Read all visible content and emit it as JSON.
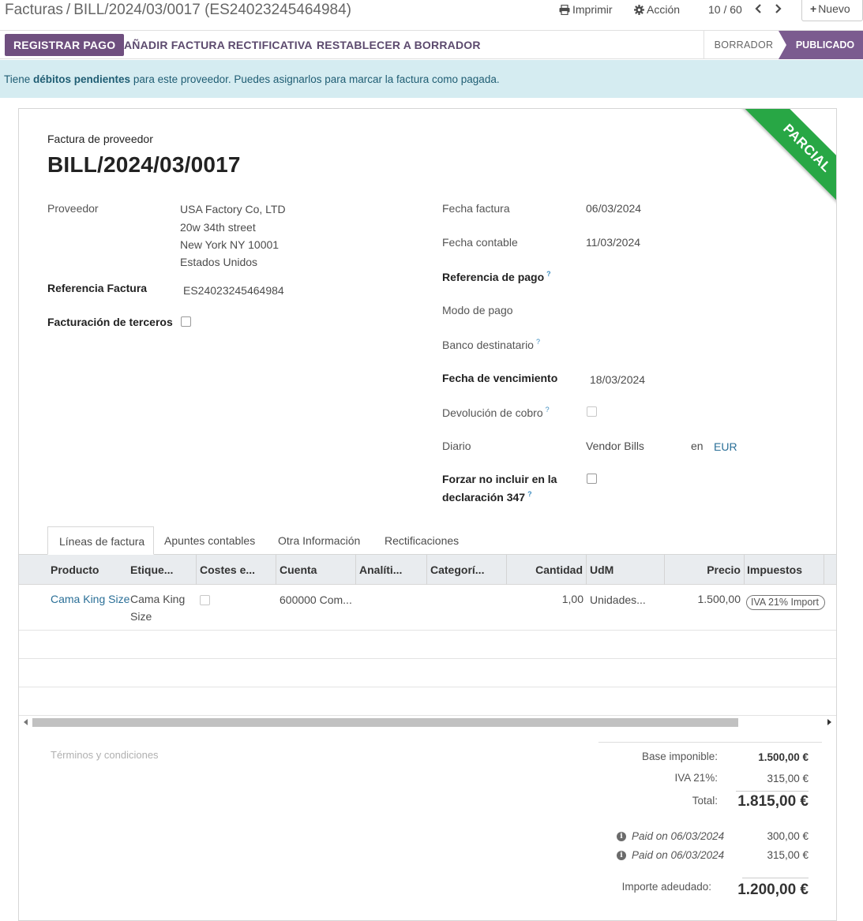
{
  "breadcrumb": {
    "parent": "Facturas",
    "separator": "/",
    "current": "BILL/2024/03/0017 (ES24023245464984)"
  },
  "toolbar": {
    "print_label": "Imprimir",
    "action_label": "Acción",
    "pager": "10 / 60",
    "new_label": "Nuevo"
  },
  "statusbar": {
    "register_payment": "REGISTRAR PAGO",
    "add_credit_note": "AÑADIR FACTURA RECTIFICATIVA",
    "reset_to_draft": "RESTABLECER A BORRADOR",
    "stages": [
      "BORRADOR",
      "PUBLICADO"
    ],
    "active_stage": "PUBLICADO"
  },
  "alert": {
    "prefix": "Tiene ",
    "bold": "débitos pendientes",
    "suffix": " para este proveedor. Puedes asignarlos para marcar la factura como pagada."
  },
  "ribbon": {
    "text": "PARCIAL",
    "color": "#28a745"
  },
  "header": {
    "doc_type": "Factura de proveedor",
    "title": "BILL/2024/03/0017"
  },
  "left_fields": {
    "vendor_label": "Proveedor",
    "vendor_name": "USA Factory Co, LTD",
    "vendor_street": "20w 34th street",
    "vendor_city": "New York NY 10001",
    "vendor_country": "Estados Unidos",
    "ref_label": "Referencia Factura",
    "ref_value": "ES24023245464984",
    "third_party_label": "Facturación de terceros",
    "third_party_checked": false
  },
  "right_fields": {
    "invoice_date_label": "Fecha factura",
    "invoice_date": "06/03/2024",
    "accounting_date_label": "Fecha contable",
    "accounting_date": "11/03/2024",
    "payment_ref_label": "Referencia de pago",
    "payment_mode_label": "Modo de pago",
    "recipient_bank_label": "Banco destinatario",
    "due_date_label": "Fecha de vencimiento",
    "due_date": "18/03/2024",
    "refund_label": "Devolución de cobro",
    "journal_label": "Diario",
    "journal": "Vendor Bills",
    "in_label": "en",
    "currency": "EUR",
    "force_347_label_1": "Forzar no incluir en la",
    "force_347_label_2": "declaración 347",
    "help_mark": "?"
  },
  "tabs": [
    "Líneas de factura",
    "Apuntes contables",
    "Otra Información",
    "Rectificaciones"
  ],
  "table": {
    "columns": [
      "Producto",
      "Etique...",
      "Costes e...",
      "Cuenta",
      "Analíti...",
      "Categorí...",
      "Cantidad",
      "UdM",
      "Precio",
      "Impuestos"
    ],
    "rows": [
      {
        "product": "Cama King Size",
        "label_1": "Cama King",
        "label_2": "Size",
        "account": "600000 Com...",
        "quantity": "1,00",
        "uom": "Unidades...",
        "price": "1.500,00",
        "tax": "IVA 21% Import"
      }
    ]
  },
  "terms_placeholder": "Términos y condiciones",
  "totals": {
    "base_label": "Base imponible:",
    "base_value": "1.500,00 €",
    "tax_label": "IVA 21%:",
    "tax_value": "315,00 €",
    "total_label": "Total:",
    "total_value": "1.815,00 €",
    "payments": [
      {
        "label": "Paid on 06/03/2024",
        "amount": "300,00 €"
      },
      {
        "label": "Paid on 06/03/2024",
        "amount": "315,00 €"
      }
    ],
    "due_label": "Importe adeudado:",
    "due_value": "1.200,00 €"
  },
  "colors": {
    "primary": "#6f4f7f",
    "alert_bg": "#d5ecf1",
    "ribbon": "#28a745",
    "stage_active": "#7b5b8f"
  }
}
